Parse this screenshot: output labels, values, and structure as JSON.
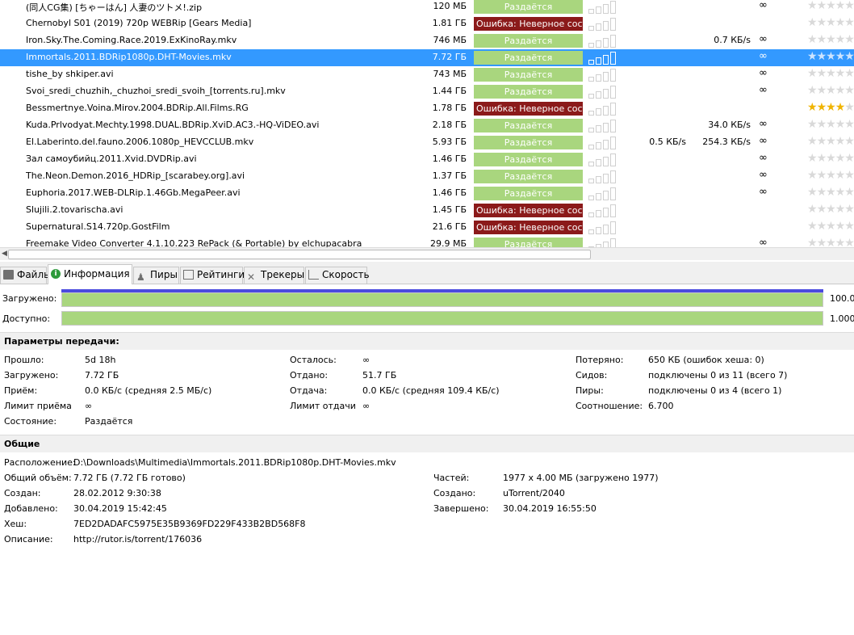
{
  "torrents": [
    {
      "name": "(同人CG集) [ちゃーはん] 人妻のツトメ!.zip",
      "size": "120 МБ",
      "status": "Раздаётся",
      "status_type": "ok",
      "down": "",
      "up": "",
      "eta": "∞",
      "rating": 0,
      "selected": false
    },
    {
      "name": "Chernobyl S01 (2019) 720p WEBRip [Gears Media]",
      "size": "1.81 ГБ",
      "status": "Ошибка: Неверное состояние",
      "status_type": "err",
      "down": "",
      "up": "",
      "eta": "",
      "rating": 0,
      "selected": false
    },
    {
      "name": "Iron.Sky.The.Coming.Race.2019.ExKinoRay.mkv",
      "size": "746 МБ",
      "status": "Раздаётся",
      "status_type": "ok",
      "down": "",
      "up": "0.7 КБ/s",
      "eta": "∞",
      "rating": 0,
      "selected": false
    },
    {
      "name": "Immortals.2011.BDRip1080p.DHT-Movies.mkv",
      "size": "7.72 ГБ",
      "status": "Раздаётся",
      "status_type": "ok",
      "down": "",
      "up": "",
      "eta": "∞",
      "rating": 0,
      "selected": true
    },
    {
      "name": "tishe_by shkiper.avi",
      "size": "743 МБ",
      "status": "Раздаётся",
      "status_type": "ok",
      "down": "",
      "up": "",
      "eta": "∞",
      "rating": 0,
      "selected": false
    },
    {
      "name": "Svoi_sredi_chuzhih,_chuzhoi_sredi_svoih_[torrents.ru].mkv",
      "size": "1.44 ГБ",
      "status": "Раздаётся",
      "status_type": "ok",
      "down": "",
      "up": "",
      "eta": "∞",
      "rating": 0,
      "selected": false
    },
    {
      "name": "Bessmertnye.Voina.Mirov.2004.BDRip.All.Films.RG",
      "size": "1.78 ГБ",
      "status": "Ошибка: Неверное состояние",
      "status_type": "err",
      "down": "",
      "up": "",
      "eta": "",
      "rating": 4,
      "selected": false
    },
    {
      "name": "Kuda.Prlvodyat.Mechty.1998.DUAL.BDRip.XviD.AC3.-HQ-ViDEO.avi",
      "size": "2.18 ГБ",
      "status": "Раздаётся",
      "status_type": "ok",
      "down": "",
      "up": "34.0 КБ/s",
      "eta": "∞",
      "rating": 0,
      "selected": false
    },
    {
      "name": "El.Laberinto.del.fauno.2006.1080p_HEVCCLUB.mkv",
      "size": "5.93 ГБ",
      "status": "Раздаётся",
      "status_type": "ok",
      "down": "0.5 КБ/s",
      "up": "254.3 КБ/s",
      "eta": "∞",
      "rating": 0,
      "selected": false
    },
    {
      "name": "Зал самоубийц.2011.Xvid.DVDRip.avi",
      "size": "1.46 ГБ",
      "status": "Раздаётся",
      "status_type": "ok",
      "down": "",
      "up": "",
      "eta": "∞",
      "rating": 0,
      "selected": false
    },
    {
      "name": "The.Neon.Demon.2016_HDRip_[scarabey.org].avi",
      "size": "1.37 ГБ",
      "status": "Раздаётся",
      "status_type": "ok",
      "down": "",
      "up": "",
      "eta": "∞",
      "rating": 0,
      "selected": false
    },
    {
      "name": "Euphoria.2017.WEB-DLRip.1.46Gb.MegaPeer.avi",
      "size": "1.46 ГБ",
      "status": "Раздаётся",
      "status_type": "ok",
      "down": "",
      "up": "",
      "eta": "∞",
      "rating": 0,
      "selected": false
    },
    {
      "name": "Slujili.2.tovarischa.avi",
      "size": "1.45 ГБ",
      "status": "Ошибка: Неверное состояние",
      "status_type": "err",
      "down": "",
      "up": "",
      "eta": "",
      "rating": 0,
      "selected": false
    },
    {
      "name": "Supernatural.S14.720p.GostFilm",
      "size": "21.6 ГБ",
      "status": "Ошибка: Неверное состояние",
      "status_type": "err",
      "down": "",
      "up": "",
      "eta": "",
      "rating": 0,
      "selected": false
    },
    {
      "name": "Freemake Video Converter 4.1.10.223 RePack (& Portable) by elchupacabra",
      "size": "29.9 МБ",
      "status": "Раздаётся",
      "status_type": "ok",
      "down": "",
      "up": "",
      "eta": "∞",
      "rating": 0,
      "selected": false
    }
  ],
  "tabs": [
    {
      "label": "Файлы",
      "icon": "folder-icon",
      "active": false
    },
    {
      "label": "Информация",
      "icon": "info-icon",
      "active": true
    },
    {
      "label": "Пиры",
      "icon": "peers-icon",
      "active": false
    },
    {
      "label": "Рейтинги",
      "icon": "ratings-icon",
      "active": false
    },
    {
      "label": "Трекеры",
      "icon": "trackers-icon",
      "active": false
    },
    {
      "label": "Скорость",
      "icon": "speed-icon",
      "active": false
    }
  ],
  "progress": {
    "downloaded_label": "Загружено:",
    "downloaded_value": "100.0",
    "downloaded_fraction": 1.0,
    "available_label": "Доступно:",
    "available_value": "1.000",
    "available_fraction": 1.0
  },
  "transfer": {
    "title": "Параметры передачи:",
    "col1": [
      {
        "k": "Прошло:",
        "v": "5d 18h"
      },
      {
        "k": "Загружено:",
        "v": "7.72 ГБ"
      },
      {
        "k": "Приём:",
        "v": "0.0 КБ/с (средняя 2.5 МБ/с)"
      },
      {
        "k": "Лимит приёма",
        "v": "∞"
      },
      {
        "k": "Состояние:",
        "v": "Раздаётся"
      }
    ],
    "col2": [
      {
        "k": "Осталось:",
        "v": "∞"
      },
      {
        "k": "Отдано:",
        "v": "51.7 ГБ"
      },
      {
        "k": "Отдача:",
        "v": "0.0 КБ/с (средняя 109.4 КБ/с)"
      },
      {
        "k": "Лимит отдачи",
        "v": "∞"
      }
    ],
    "col3": [
      {
        "k": "Потеряно:",
        "v": "650 КБ (ошибок хеша: 0)"
      },
      {
        "k": "Сидов:",
        "v": "подключены 0 из 11 (всего 7)"
      },
      {
        "k": "Пиры:",
        "v": "подключены 0 из 4 (всего 1)"
      },
      {
        "k": "Соотношение:",
        "v": "6.700"
      }
    ]
  },
  "general": {
    "title": "Общие",
    "location_label": "Расположение:",
    "location_value": "D:\\Downloads\\Multimedia\\Immortals.2011.BDRip1080p.DHT-Movies.mkv",
    "col1": [
      {
        "k": "Общий объём:",
        "v": "7.72 ГБ (7.72 ГБ готово)"
      },
      {
        "k": "Создан:",
        "v": "28.02.2012 9:30:38"
      },
      {
        "k": "Добавлено:",
        "v": "30.04.2019 15:42:45"
      },
      {
        "k": "Хеш:",
        "v": "7ED2DADAFC5975E35B9369FD229F433B2BD568F8"
      },
      {
        "k": "Описание:",
        "v": "http://rutor.is/torrent/176036"
      }
    ],
    "col2": [
      {
        "k": "Частей:",
        "v": "1977 x 4.00 МБ (загружено 1977)"
      },
      {
        "k": "Создано:",
        "v": "uTorrent/2040"
      },
      {
        "k": "Завершено:",
        "v": "30.04.2019 16:55:50"
      }
    ]
  },
  "colors": {
    "selected_row": "#3399ff",
    "status_ok": "#a9d67e",
    "status_err": "#8b1a1a",
    "rating_star": "#f0b400"
  }
}
